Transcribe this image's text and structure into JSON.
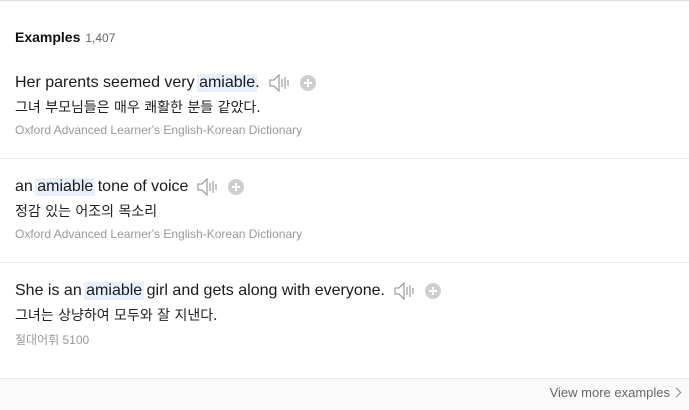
{
  "section": {
    "title": "Examples",
    "count": "1,407"
  },
  "examples": [
    {
      "before": "Her parents seemed very ",
      "highlight": "amiable",
      "after": ".",
      "translation": "그녀 부모님들은 매우 쾌활한 분들 같았다.",
      "source": "Oxford Advanced Learner's English-Korean Dictionary"
    },
    {
      "before": "an ",
      "highlight": "amiable",
      "after": " tone of voice",
      "translation": "정감 있는 어조의 목소리",
      "source": "Oxford Advanced Learner's English-Korean Dictionary"
    },
    {
      "before": "She is an ",
      "highlight": "amiable",
      "after": " girl and gets along with everyone.",
      "translation": "그녀는 상냥하여 모두와 잘 지낸다.",
      "source": "절대어휘 5100"
    }
  ],
  "footer": {
    "view_more_label": "View more examples"
  },
  "icons": {
    "speaker": "speaker-icon",
    "add": "plus-circle-icon",
    "more": "chevron-right-icon"
  },
  "colors": {
    "highlight": "#e7f0fb",
    "icon_gray": "#cfcfcf",
    "source_text": "#999999"
  }
}
